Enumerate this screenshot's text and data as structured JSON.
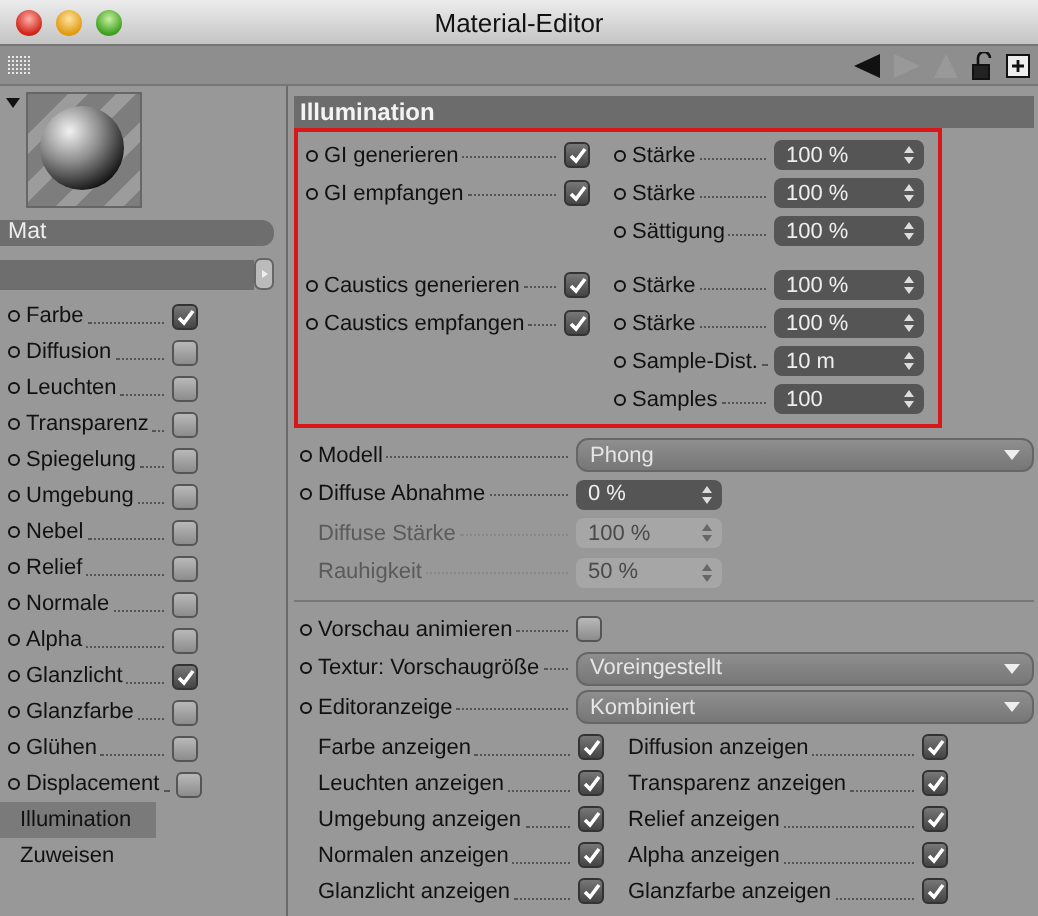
{
  "window": {
    "title": "Material-Editor"
  },
  "material": {
    "name": "Mat"
  },
  "channels": [
    {
      "label": "Farbe",
      "kind": "check",
      "checked": true,
      "selected": false
    },
    {
      "label": "Diffusion",
      "kind": "check",
      "checked": false,
      "selected": false
    },
    {
      "label": "Leuchten",
      "kind": "check",
      "checked": false,
      "selected": false
    },
    {
      "label": "Transparenz",
      "kind": "check",
      "checked": false,
      "selected": false
    },
    {
      "label": "Spiegelung",
      "kind": "check",
      "checked": false,
      "selected": false
    },
    {
      "label": "Umgebung",
      "kind": "check",
      "checked": false,
      "selected": false
    },
    {
      "label": "Nebel",
      "kind": "check",
      "checked": false,
      "selected": false
    },
    {
      "label": "Relief",
      "kind": "check",
      "checked": false,
      "selected": false
    },
    {
      "label": "Normale",
      "kind": "check",
      "checked": false,
      "selected": false
    },
    {
      "label": "Alpha",
      "kind": "check",
      "checked": false,
      "selected": false
    },
    {
      "label": "Glanzlicht",
      "kind": "check",
      "checked": true,
      "selected": false
    },
    {
      "label": "Glanzfarbe",
      "kind": "check",
      "checked": false,
      "selected": false
    },
    {
      "label": "Glühen",
      "kind": "check",
      "checked": false,
      "selected": false
    },
    {
      "label": "Displacement",
      "kind": "check",
      "checked": false,
      "selected": false
    },
    {
      "label": "Illumination",
      "kind": "page",
      "selected": true
    },
    {
      "label": "Zuweisen",
      "kind": "page",
      "selected": false
    }
  ],
  "illumination": {
    "title": "Illumination",
    "groups": [
      {
        "rows": [
          {
            "left": {
              "label": "GI generieren",
              "checked": true
            },
            "right": {
              "label": "Stärke",
              "value": "100 %"
            }
          },
          {
            "left": {
              "label": "GI empfangen",
              "checked": true
            },
            "right": {
              "label": "Stärke",
              "value": "100 %"
            }
          },
          {
            "right": {
              "label": "Sättigung",
              "value": "100 %"
            }
          }
        ]
      },
      {
        "rows": [
          {
            "left": {
              "label": "Caustics generieren",
              "checked": true
            },
            "right": {
              "label": "Stärke",
              "value": "100 %"
            }
          },
          {
            "left": {
              "label": "Caustics empfangen",
              "checked": true
            },
            "right": {
              "label": "Stärke",
              "value": "100 %"
            }
          },
          {
            "right": {
              "label": "Sample-Dist.",
              "value": "10 m"
            }
          },
          {
            "right": {
              "label": "Samples",
              "value": "100"
            }
          }
        ]
      }
    ]
  },
  "options": [
    {
      "kind": "dropdown",
      "label": "Modell",
      "value": "Phong",
      "animatable": true,
      "disabled": false
    },
    {
      "kind": "spin",
      "label": "Diffuse Abnahme",
      "value": "0 %",
      "animatable": true,
      "disabled": false
    },
    {
      "kind": "spin",
      "label": "Diffuse Stärke",
      "value": "100 %",
      "animatable": false,
      "disabled": true
    },
    {
      "kind": "spin",
      "label": "Rauhigkeit",
      "value": "50 %",
      "animatable": false,
      "disabled": true
    },
    {
      "kind": "divider"
    },
    {
      "kind": "checkbox",
      "label": "Vorschau animieren",
      "checked": false,
      "animatable": true,
      "disabled": false
    },
    {
      "kind": "dropdown",
      "label": "Textur: Vorschaugröße",
      "value": "Voreingestellt",
      "animatable": true,
      "disabled": false
    },
    {
      "kind": "dropdown",
      "label": "Editoranzeige",
      "value": "Kombiniert",
      "animatable": true,
      "disabled": false
    }
  ],
  "display": [
    {
      "label": "Farbe anzeigen",
      "checked": true
    },
    {
      "label": "Diffusion anzeigen",
      "checked": true
    },
    {
      "label": "Leuchten anzeigen",
      "checked": true
    },
    {
      "label": "Transparenz anzeigen",
      "checked": true
    },
    {
      "label": "Umgebung anzeigen",
      "checked": true
    },
    {
      "label": "Relief anzeigen",
      "checked": true
    },
    {
      "label": "Normalen anzeigen",
      "checked": true
    },
    {
      "label": "Alpha anzeigen",
      "checked": true
    },
    {
      "label": "Glanzlicht anzeigen",
      "checked": true
    },
    {
      "label": "Glanzfarbe anzeigen",
      "checked": true
    }
  ]
}
